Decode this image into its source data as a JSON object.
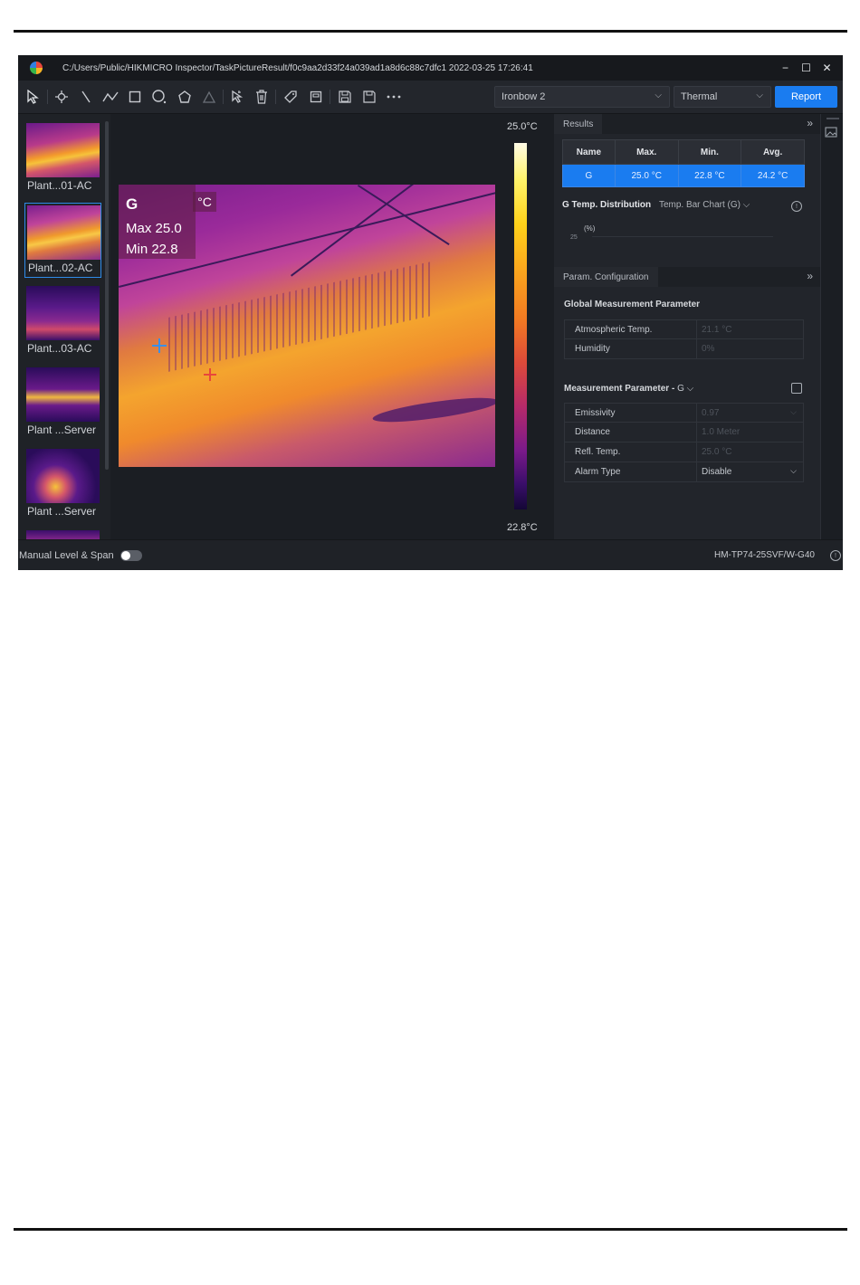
{
  "window": {
    "title_path": "C:/Users/Public/HIKMICRO Inspector/TaskPictureResult/f0c9aa2d33f24a039ad1a8d6c88c7dfc1 2022-03-25 17:26:41",
    "controls": [
      "−",
      "☐",
      "✕"
    ]
  },
  "toolbar": {
    "tools": [
      "select-arrow",
      "point",
      "line",
      "polyline",
      "rectangle",
      "circle",
      "polygon",
      "triangle",
      "pointer-select",
      "delete",
      "tag",
      "frame",
      "save-as",
      "save",
      "more"
    ],
    "palette_value": "Ironbow 2",
    "mode_value": "Thermal",
    "report_label": "Report"
  },
  "thumbnails": [
    {
      "caption": "Plant...01-AC"
    },
    {
      "caption": "Plant...02-AC"
    },
    {
      "caption": "Plant...03-AC"
    },
    {
      "caption": "Plant ...Server"
    },
    {
      "caption": "Plant ...Server"
    }
  ],
  "viewer": {
    "overlay": {
      "label": "G",
      "unit": "°C",
      "max": "Max 25.0",
      "min": "Min  22.8"
    },
    "scale_max": "25.0°C",
    "scale_min": "22.8°C",
    "collapse_icon": "«"
  },
  "results": {
    "tab_label": "Results",
    "expand_icon": "»",
    "columns": [
      "Name",
      "Max.",
      "Min.",
      "Avg."
    ],
    "rows": [
      [
        "G",
        "25.0 °C",
        "22.8 °C",
        "24.2 °C"
      ]
    ]
  },
  "distribution": {
    "title": "G Temp. Distribution",
    "chart_type": "Temp. Bar Chart (G)",
    "y_unit": "(%)",
    "y_tick": "25"
  },
  "param_config": {
    "tab_label": "Param. Configuration",
    "expand_icon": "»",
    "global_title": "Global Measurement Parameter",
    "global_params": [
      {
        "label": "Atmospheric Temp.",
        "value": "21.1 °C"
      },
      {
        "label": "Humidity",
        "value": "0%"
      }
    ],
    "measure_title": "Measurement Parameter",
    "measure_target": "G",
    "measure_params": [
      {
        "label": "Emissivity",
        "value": "0.97"
      },
      {
        "label": "Distance",
        "value": "1.0 Meter"
      },
      {
        "label": "Refl. Temp.",
        "value": "25.0 °C"
      },
      {
        "label": "Alarm Type",
        "value": "Disable"
      }
    ]
  },
  "status": {
    "level_span_label": "Manual Level & Span",
    "toggle_on": false,
    "model": "HM-TP74-25SVF/W-G40"
  },
  "colors": {
    "accent": "#1a7cf0",
    "app_bg": "#1b1e23",
    "panel_bg": "#22252b"
  }
}
